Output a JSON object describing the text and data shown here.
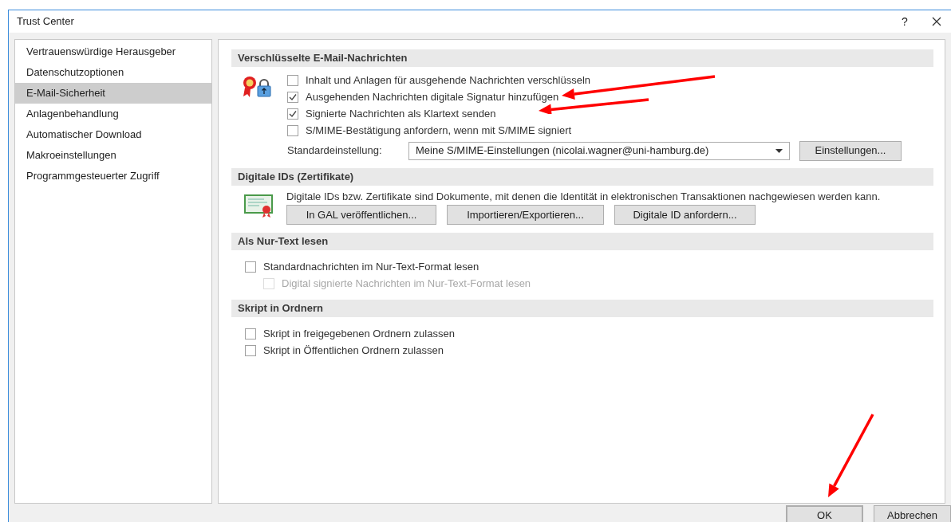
{
  "window": {
    "title": "Trust Center",
    "help": "?"
  },
  "sidebar": {
    "items": [
      {
        "label": "Vertrauenswürdige Herausgeber",
        "selected": false
      },
      {
        "label": "Datenschutzoptionen",
        "selected": false
      },
      {
        "label": "E-Mail-Sicherheit",
        "selected": true
      },
      {
        "label": "Anlagenbehandlung",
        "selected": false
      },
      {
        "label": "Automatischer Download",
        "selected": false
      },
      {
        "label": "Makroeinstellungen",
        "selected": false
      },
      {
        "label": "Programmgesteuerter Zugriff",
        "selected": false
      }
    ]
  },
  "sections": [
    {
      "kind": "encryption",
      "title": "Verschlüsselte E-Mail-Nachrichten",
      "checkboxes": [
        {
          "label": "Inhalt und Anlagen für ausgehende Nachrichten verschlüsseln",
          "checked": false,
          "disabled": false,
          "annotated": false
        },
        {
          "label": "Ausgehenden Nachrichten digitale Signatur hinzufügen",
          "checked": true,
          "disabled": false,
          "annotated": true
        },
        {
          "label": "Signierte Nachrichten als Klartext senden",
          "checked": true,
          "disabled": false,
          "annotated": true
        },
        {
          "label": "S/MIME-Bestätigung anfordern, wenn mit S/MIME signiert",
          "checked": false,
          "disabled": false,
          "annotated": false
        }
      ],
      "default_setting": {
        "label": "Standardeinstellung:",
        "value": "Meine S/MIME-Einstellungen (nicolai.wagner@uni-hamburg.de)",
        "button": "Einstellungen..."
      }
    },
    {
      "kind": "certificates",
      "title": "Digitale IDs (Zertifikate)",
      "description": "Digitale IDs bzw. Zertifikate sind Dokumente, mit denen die Identität in elektronischen Transaktionen nachgewiesen werden kann.",
      "buttons": [
        "In GAL veröffentlichen...",
        "Importieren/Exportieren...",
        "Digitale ID anfordern..."
      ]
    },
    {
      "kind": "options",
      "title": "Als Nur-Text lesen",
      "checkboxes": [
        {
          "label": "Standardnachrichten im Nur-Text-Format lesen",
          "checked": false,
          "disabled": false,
          "annotated": false,
          "children": [
            {
              "label": "Digital signierte Nachrichten im Nur-Text-Format lesen",
              "checked": false,
              "disabled": true,
              "annotated": false
            }
          ]
        }
      ]
    },
    {
      "kind": "options",
      "title": "Skript in Ordnern",
      "checkboxes": [
        {
          "label": "Skript in freigegebenen Ordnern zulassen",
          "checked": false,
          "disabled": false,
          "annotated": false
        },
        {
          "label": "Skript in Öffentlichen Ordnern zulassen",
          "checked": false,
          "disabled": false,
          "annotated": false
        }
      ]
    }
  ],
  "buttons": [
    {
      "label": "OK",
      "default": true,
      "annotated": true
    },
    {
      "label": "Abbrechen",
      "default": false,
      "annotated": false
    }
  ]
}
